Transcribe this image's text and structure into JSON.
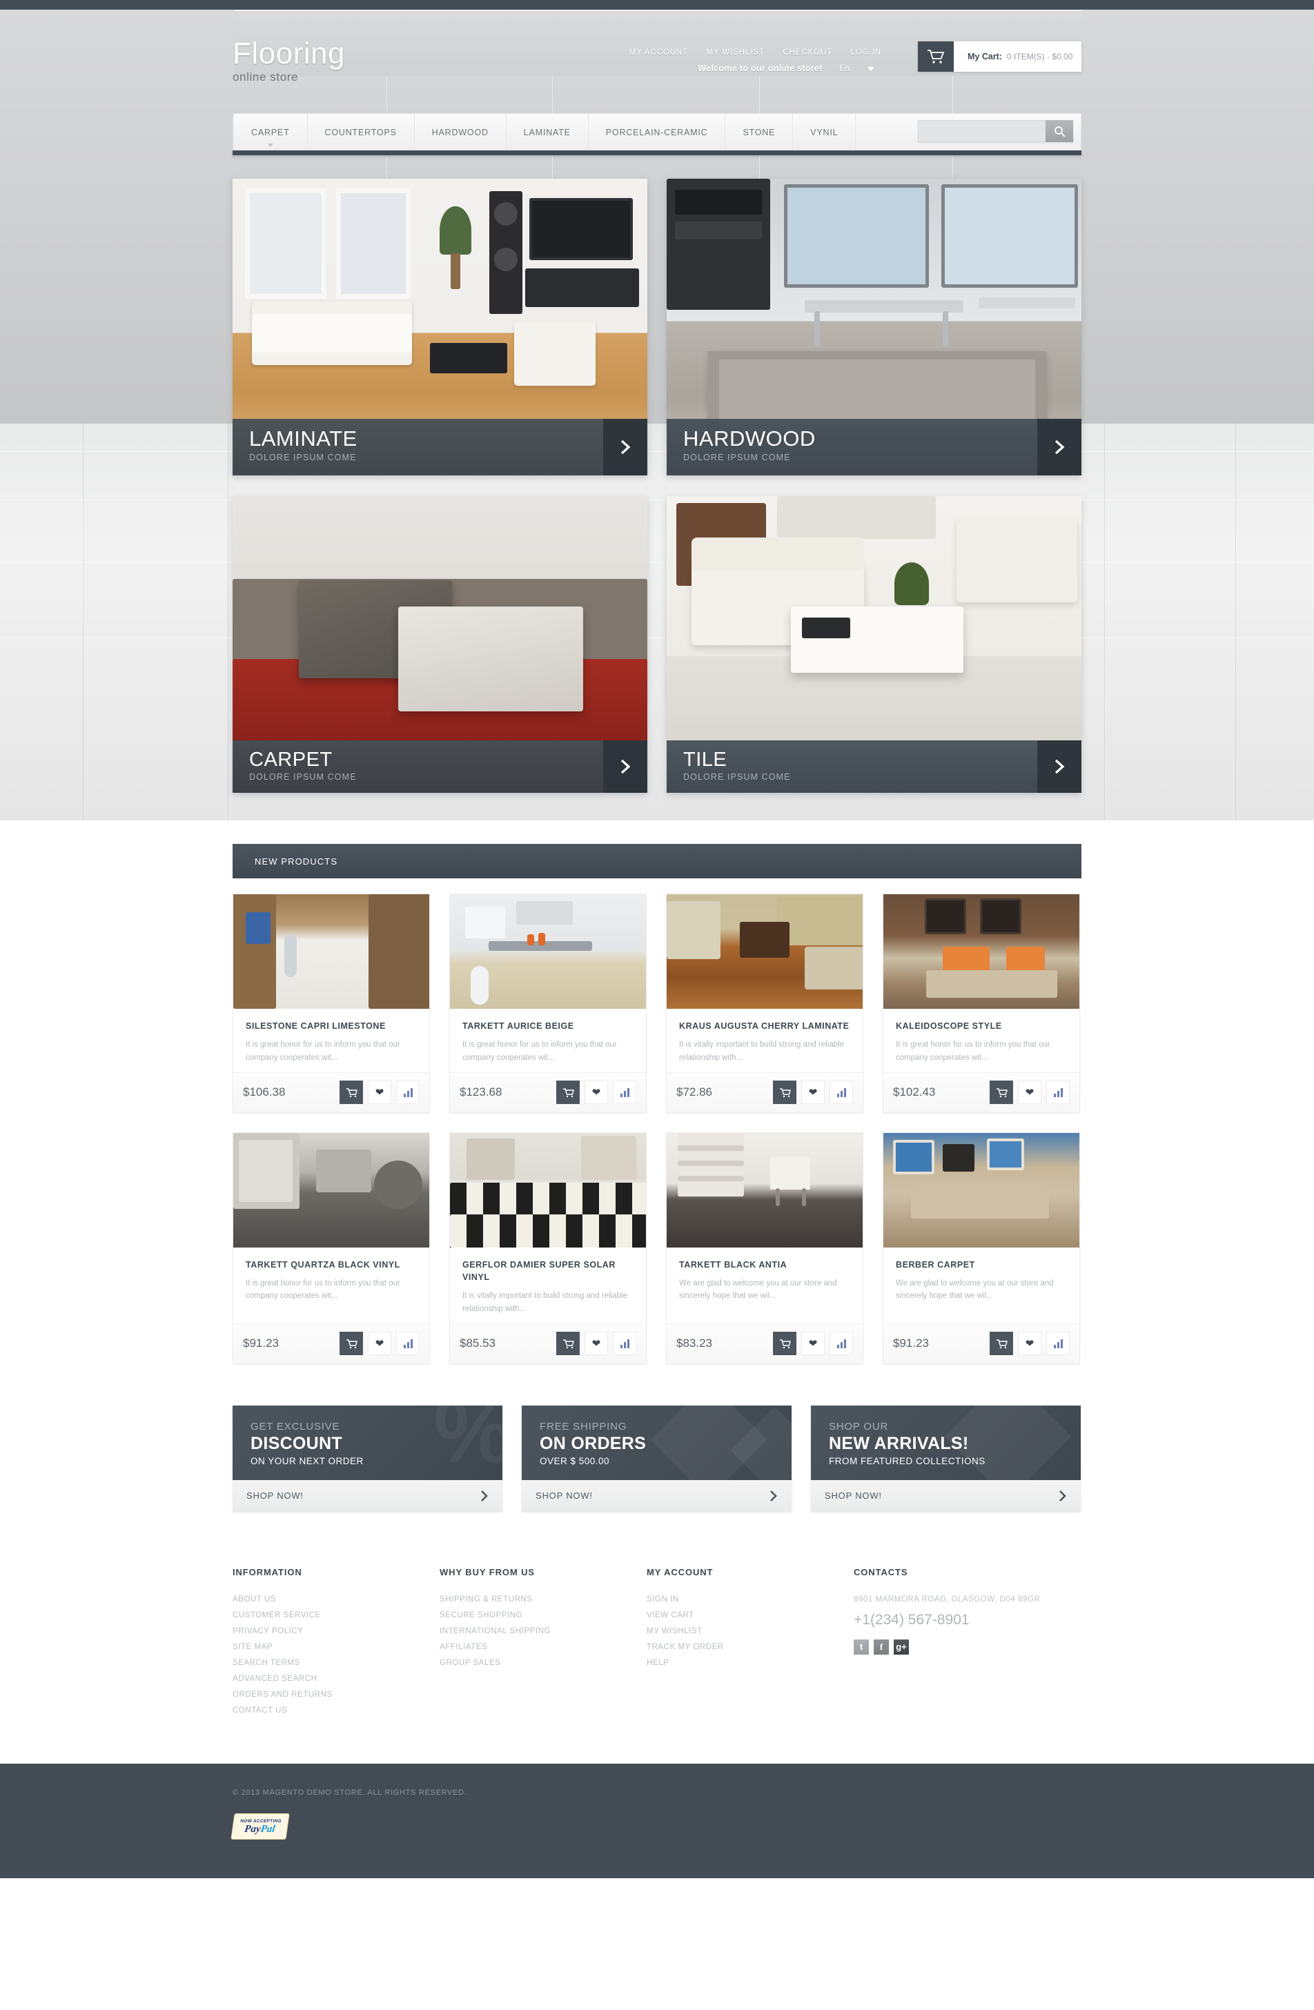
{
  "header": {
    "logo_title": "Flooring",
    "logo_subtitle": "online store",
    "util_links": [
      {
        "label": "MY ACCOUNT"
      },
      {
        "label": "MY WISHLIST"
      },
      {
        "label": "CHECKOUT"
      },
      {
        "label": "LOG IN"
      }
    ],
    "welcome_text": "Welcome to our online store!",
    "language": "En",
    "cart": {
      "label": "My Cart:",
      "value": "0 ITEM(S) - $0.00"
    }
  },
  "nav": {
    "items": [
      {
        "label": "CARPET",
        "has_dropdown": true
      },
      {
        "label": "COUNTERTOPS",
        "has_dropdown": false
      },
      {
        "label": "HARDWOOD",
        "has_dropdown": false
      },
      {
        "label": "LAMINATE",
        "has_dropdown": false
      },
      {
        "label": "PORCELAIN-CERAMIC",
        "has_dropdown": false
      },
      {
        "label": "STONE",
        "has_dropdown": false
      },
      {
        "label": "VYNIL",
        "has_dropdown": false
      }
    ],
    "search_value": "",
    "search_placeholder": ""
  },
  "categories": [
    {
      "title": "LAMINATE",
      "subtitle": "DOLORE IPSUM COME"
    },
    {
      "title": "HARDWOOD",
      "subtitle": "DOLORE IPSUM COME"
    },
    {
      "title": "CARPET",
      "subtitle": "DOLORE IPSUM COME"
    },
    {
      "title": "TILE",
      "subtitle": "DOLORE IPSUM COME"
    }
  ],
  "new_products": {
    "heading": "NEW PRODUCTS",
    "items": [
      {
        "name": "SILESTONE CAPRI LIMESTONE",
        "desc": "It is great honor for us to inform you that our company cooperates wit...",
        "price": "$106.38"
      },
      {
        "name": "TARKETT AURICE BEIGE",
        "desc": "It is great honor for us to inform you that our company cooperates wit...",
        "price": "$123.68"
      },
      {
        "name": "KRAUS AUGUSTA CHERRY LAMINATE",
        "desc": "It is vitally important to build strong and reliable relationship with...",
        "price": "$72.86"
      },
      {
        "name": "KALEIDOSCOPE STYLE",
        "desc": "It is great honor for us to inform you that our company cooperates wit...",
        "price": "$102.43"
      },
      {
        "name": "TARKETT QUARTZA BLACK VINYL",
        "desc": "It is great honor for us to inform you that our company cooperates wit...",
        "price": "$91.23"
      },
      {
        "name": "GERFLOR DAMIER SUPER SOLAR VINYL",
        "desc": "It is vitally important to build strong and reliable relationship with...",
        "price": "$85.53"
      },
      {
        "name": "TARKETT BLACK ANTIA",
        "desc": "We are glad to welcome you at our store and sincerely hope that we wil...",
        "price": "$83.23"
      },
      {
        "name": "BERBER CARPET",
        "desc": "We are glad to welcome you at our store and sincerely hope that we wil...",
        "price": "$91.23"
      }
    ]
  },
  "promos": [
    {
      "line1": "GET EXCLUSIVE",
      "line2": "DISCOUNT",
      "line3": "ON YOUR NEXT ORDER",
      "cta": "SHOP NOW!",
      "ghost": "%"
    },
    {
      "line1": "FREE SHIPPING",
      "line2": "ON ORDERS",
      "line3": "OVER $ 500.00",
      "cta": "SHOP NOW!",
      "ghost": ""
    },
    {
      "line1": "SHOP OUR",
      "line2": "NEW ARRIVALS!",
      "line3": "FROM FEATURED COLLECTIONS",
      "cta": "SHOP NOW!",
      "ghost": ""
    }
  ],
  "footer": {
    "columns": [
      {
        "title": "INFORMATION",
        "links": [
          {
            "label": "ABOUT US"
          },
          {
            "label": "CUSTOMER SERVICE"
          },
          {
            "label": "PRIVACY POLICY"
          },
          {
            "label": "SITE MAP"
          },
          {
            "label": "SEARCH TERMS"
          },
          {
            "label": "ADVANCED SEARCH"
          },
          {
            "label": "ORDERS AND RETURNS"
          },
          {
            "label": "CONTACT US"
          }
        ]
      },
      {
        "title": "WHY BUY FROM US",
        "links": [
          {
            "label": "SHIPPING & RETURNS"
          },
          {
            "label": "SECURE SHOPPING"
          },
          {
            "label": "INTERNATIONAL SHIPPING"
          },
          {
            "label": "AFFILIATES"
          },
          {
            "label": "GROUP SALES"
          }
        ]
      },
      {
        "title": "MY ACCOUNT",
        "links": [
          {
            "label": "SIGN IN"
          },
          {
            "label": "VIEW CART"
          },
          {
            "label": "MY WISHLIST"
          },
          {
            "label": "TRACK MY ORDER"
          },
          {
            "label": "HELP"
          }
        ]
      }
    ],
    "contacts": {
      "title": "CONTACTS",
      "address": "8901 MARMORA ROAD, GLASGOW, D04 89GR",
      "phone": "+1(234) 567-8901",
      "social": [
        {
          "name": "twitter-icon",
          "glyph": "t"
        },
        {
          "name": "facebook-icon",
          "glyph": "f"
        },
        {
          "name": "google-plus-icon",
          "glyph": "g+"
        }
      ]
    }
  },
  "bottom": {
    "copyright": "© 2013 MAGENTO DEMO STORE. ALL RIGHTS RESERVED.",
    "paypal_top": "NOW ACCEPTING",
    "paypal_pay": "Pay",
    "paypal_pal": "Pal"
  },
  "colors": {
    "dark": "#434c55",
    "slate": "#4d565f",
    "muted": "#b3b7bb"
  }
}
